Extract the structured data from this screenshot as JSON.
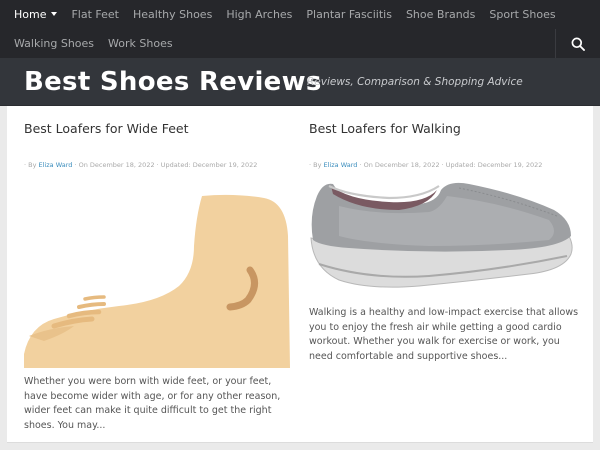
{
  "nav": {
    "row1": [
      {
        "label": "Home",
        "active": true
      },
      {
        "label": "Flat Feet"
      },
      {
        "label": "Healthy Shoes"
      },
      {
        "label": "High Arches"
      },
      {
        "label": "Plantar Fasciitis"
      },
      {
        "label": "Shoe Brands"
      },
      {
        "label": "Sport Shoes"
      }
    ],
    "row2": [
      {
        "label": "Walking Shoes"
      },
      {
        "label": "Work Shoes"
      }
    ],
    "search_icon": "search-icon"
  },
  "header": {
    "title": "Best Shoes Reviews",
    "tagline": "Reviews, Comparison & Shopping Advice"
  },
  "posts": [
    {
      "title": "Best Loafers for Wide Feet",
      "meta_by": "· By ",
      "author": "Eliza Ward",
      "meta_dates": " · On December 18, 2022 · Updated: December 19, 2022",
      "image": "wide-foot-illustration",
      "excerpt": "Whether you were born with wide feet, or your feet, have become wider with age, or for any other reason, wider feet can make it quite difficult to get the right shoes. You may..."
    },
    {
      "title": "Best Loafers for Walking",
      "meta_by": "· By ",
      "author": "Eliza Ward",
      "meta_dates": " · On December 18, 2022 · Updated: December 19, 2022",
      "image": "grey-slip-on-walking-shoe",
      "excerpt": "Walking is a healthy and low-impact exercise that allows you to enjoy the fresh air while getting a good cardio workout. Whether you walk for exercise or work, you need comfortable and supportive shoes..."
    }
  ],
  "colors": {
    "nav_bg": "#26272b",
    "header_bg": "#33363b",
    "link": "#3b8dbd",
    "skin": "#f2d19f"
  }
}
